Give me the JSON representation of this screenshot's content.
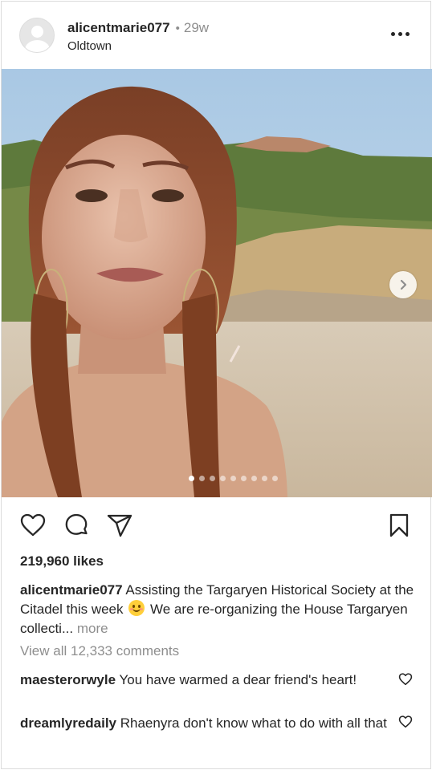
{
  "post": {
    "username": "alicentmarie077",
    "separator": "•",
    "time_ago": "29w",
    "location": "Oldtown",
    "likes": "219,960 likes",
    "caption": {
      "username": "alicentmarie077",
      "text_before_emoji": "Assisting the Targaryen Historical Society at the Citadel this week",
      "emoji": "smiling-face-emoji",
      "text_after_emoji": "We are re-organizing the House Targaryen collecti...",
      "more_label": "more"
    },
    "view_comments": "View all 12,333 comments",
    "carousel": {
      "total_slides": 9,
      "current_slide": 1
    },
    "comments": [
      {
        "username": "maesterorwyle",
        "text": "You have warmed a dear friend's heart!"
      },
      {
        "username": "dreamlyredaily",
        "text": "Rhaenyra don't know what to do with all that"
      }
    ]
  },
  "icons": {
    "more": "more-options-icon",
    "like": "heart-icon",
    "comment": "comment-bubble-icon",
    "share": "paper-plane-icon",
    "save": "bookmark-icon",
    "next": "chevron-right-icon"
  },
  "colors": {
    "text": "#262626",
    "secondary_text": "#8e8e8e",
    "border": "#dbdbdb"
  }
}
